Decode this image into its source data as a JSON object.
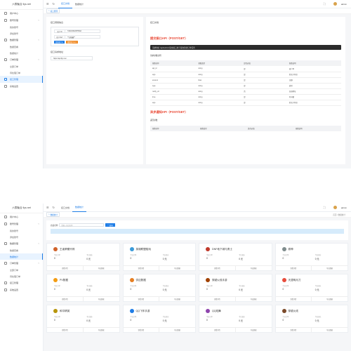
{
  "app": {
    "logo": "六零聚合 llys.net",
    "user": "admin"
  },
  "sidebar": {
    "items": [
      {
        "label": "用户中心"
      },
      {
        "label": "账号管理"
      },
      {
        "label": "我的账号"
      },
      {
        "label": "添加账号"
      },
      {
        "label": "数据管理"
      },
      {
        "label": "数据查看"
      },
      {
        "label": "数据统计"
      },
      {
        "label": "订单管理"
      },
      {
        "label": "全部订单"
      },
      {
        "label": "待处理订单"
      },
      {
        "label": "接口管理"
      },
      {
        "label": "系统设置"
      }
    ]
  },
  "shot1": {
    "tabs": [
      "接口文档",
      "数据统计"
    ],
    "crumb": "接口管理",
    "left_panel": {
      "title": "接口调用信息",
      "fields": [
        {
          "label": "商户ID",
          "value": "7d4cb3b42f37f04d"
        },
        {
          "label": "商户KEY",
          "value": "**已隐藏**"
        }
      ],
      "buttons": [
        "复制商户ID",
        "重置商户KEY"
      ],
      "url_title": "接口请求地址",
      "url": "https://api.llys.net"
    },
    "right_panel": {
      "title": "接口文档",
      "api1_title": "提交接口API（POST/GET）",
      "api1_bar": "请求地址 /api/submit    提交接口用于提交新的订单任务",
      "param_title": "请求参数说明",
      "headers": [
        "参数名称",
        "参数类型",
        "是否必填",
        "参数说明"
      ],
      "rows": [
        [
          "api_id",
          "string",
          "是",
          "商户ID"
        ],
        [
          "sign",
          "string",
          "是",
          "签名字符串"
        ],
        [
          "amount",
          "float",
          "是",
          "金额"
        ],
        [
          "type",
          "string",
          "是",
          "类型"
        ],
        [
          "notify_url",
          "string",
          "否",
          "回调地址"
        ],
        [
          "time",
          "string",
          "是",
          "时间戳"
        ],
        [
          "sign",
          "string",
          "是",
          "签名字符串"
        ]
      ],
      "api2_title": "异步通知API（POST/GET）",
      "resp_label": "返回参数",
      "resp_headers": [
        "参数名称",
        "参数类型",
        "是否必填",
        "参数说明"
      ]
    }
  },
  "shot2": {
    "tabs": [
      "接口文档",
      "数据统计"
    ],
    "crumb": "数据统计",
    "crumb_right": "首页 / 数据统计",
    "search_label": "商品名称",
    "search_placeholder": "请输入商品名称",
    "search_button": "查询",
    "stat_labels": [
      "今日订单",
      "今日流水"
    ],
    "footer": [
      "查看详情",
      "导出数据"
    ],
    "cards": [
      {
        "name": "王者荣耀代练",
        "color": "#d0622a",
        "orders": "0",
        "flow": "0 元"
      },
      {
        "name": "英雄联盟陪玩",
        "color": "#3a9ad9",
        "orders": "0",
        "flow": "0 元"
      },
      {
        "name": "DNF地下城与勇士",
        "color": "#c0392b",
        "orders": "0",
        "flow": "0 元"
      },
      {
        "name": "原神",
        "color": "#7f8c8d",
        "orders": "0",
        "flow": "0 元"
      },
      {
        "name": "PV数据",
        "color": "#f39c12",
        "orders": "0",
        "flow": "0 元"
      },
      {
        "name": "供应数据",
        "color": "#e67e22",
        "orders": "0",
        "flow": "0 元"
      },
      {
        "name": "穿越火线手游",
        "color": "#a04000",
        "orders": "0",
        "flow": "0 元"
      },
      {
        "name": "天涯明月刀",
        "color": "#e74c3c",
        "orders": "0",
        "flow": "0 元"
      },
      {
        "name": "和平精英",
        "color": "#b7950b",
        "orders": "0",
        "flow": "0 元"
      },
      {
        "name": "QQ飞车手游",
        "color": "#1f7de6",
        "orders": "0",
        "flow": "0 元"
      },
      {
        "name": "QQ炫舞",
        "color": "#8e44ad",
        "orders": "0",
        "flow": "0 元"
      },
      {
        "name": "穿越火线",
        "color": "#7b4a2a",
        "orders": "0",
        "flow": "0 元"
      }
    ]
  }
}
